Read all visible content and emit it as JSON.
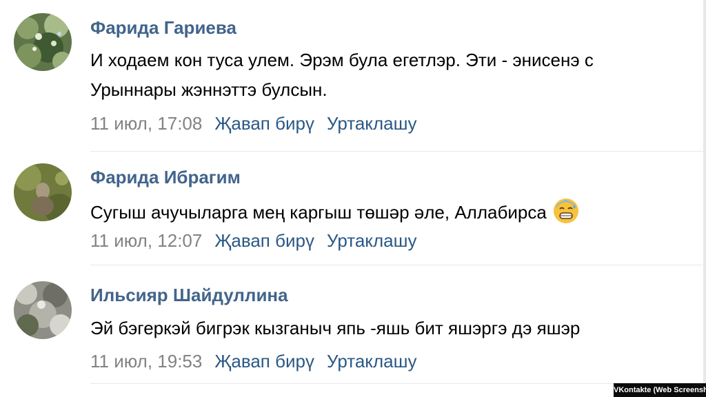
{
  "comments": [
    {
      "author": "Фарида Гариева",
      "lines": [
        "И ходаем кон туса улем. Эрэм була егетлэр. Эти - энисенэ с",
        "Урыннары жэннэттэ булсын."
      ],
      "time": "11 июл, 17:08",
      "reply": "Җавап бирү",
      "share": "Уртаклашу"
    },
    {
      "author": "Фарида Ибрагим",
      "lines": [
        "Сугыш ачучыларга мең каргыш төшәр әле, Аллабирса"
      ],
      "emoji_icon": "cold-sweat-face-emoji",
      "time": "11 июл, 12:07",
      "reply": "Җавап бирү",
      "share": "Уртаклашу"
    },
    {
      "author": "Ильсияр Шайдуллина",
      "lines": [
        "Эй бэгеркэй бигрэк кызганыч япь -яшь бит яшэргэ дэ яшэр"
      ],
      "time": "11 июл, 19:53",
      "reply": "Җавап бирү",
      "share": "Уртаклашу"
    }
  ],
  "watermark": "VKontakte (Web Screenshot)",
  "colors": {
    "author": "#42648b",
    "action": "#2a5885",
    "time": "#828282"
  }
}
